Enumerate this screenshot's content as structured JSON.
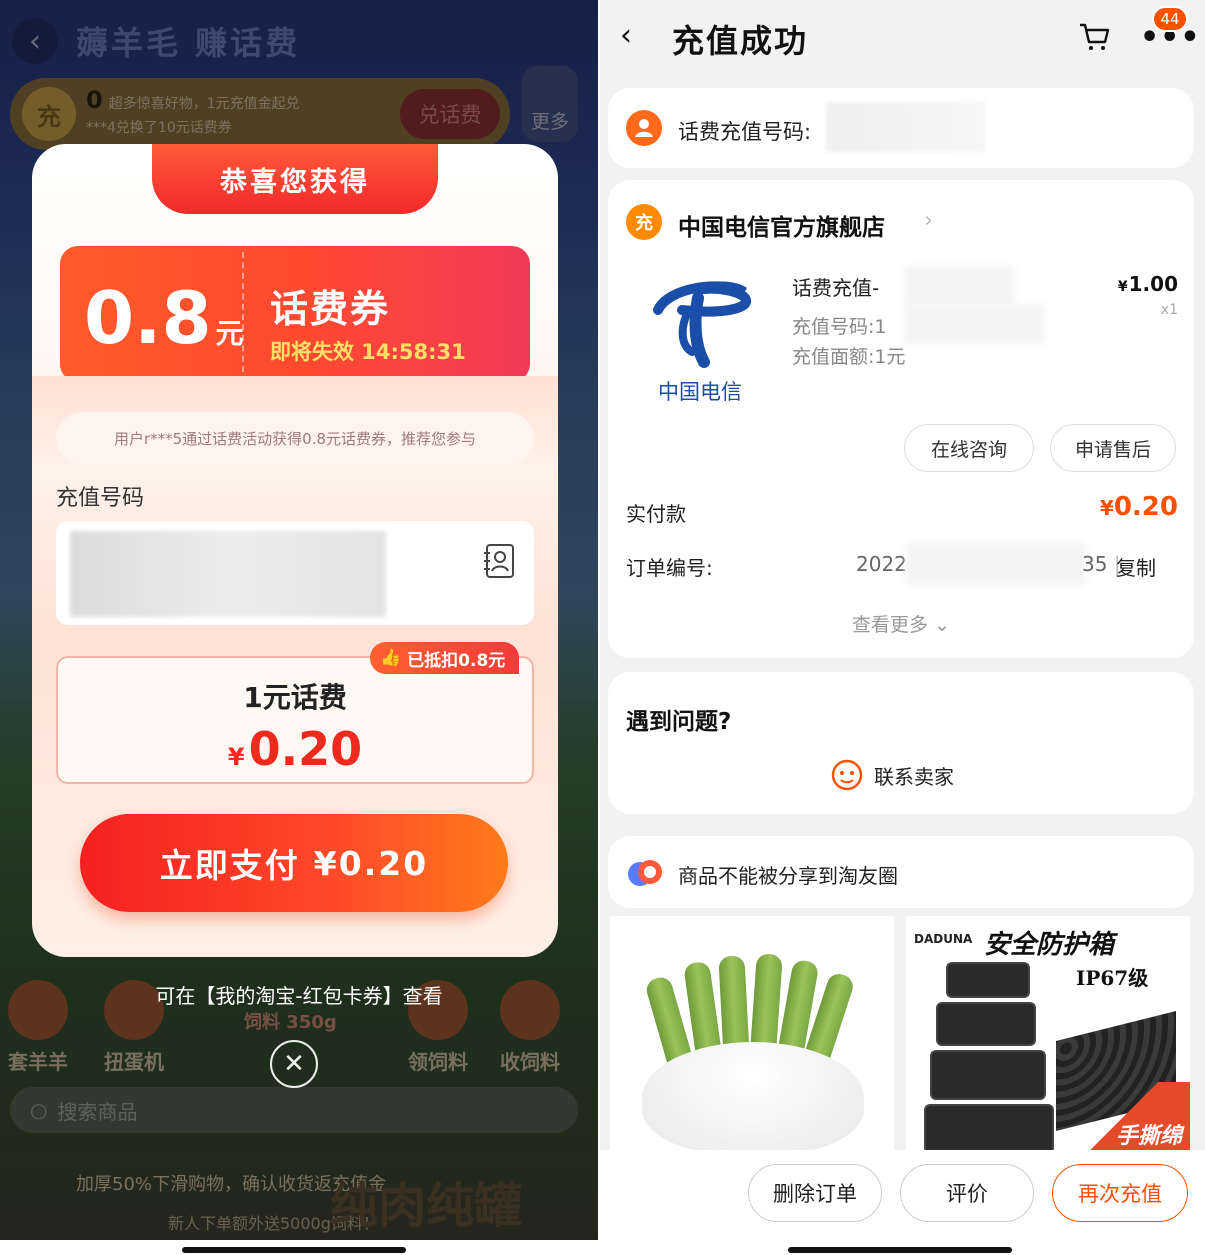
{
  "left": {
    "game": {
      "title": "薅羊毛 赚话费",
      "banner_count": "0",
      "banner_line1": "超多惊喜好物，1元充值金起兑",
      "banner_line2": "***4兑换了10元话费券",
      "banner_badge": "充",
      "banner_button": "兑话费",
      "more_label": "更多",
      "icons": [
        "套羊羊",
        "扭蛋机",
        "领饲料",
        "收饲料"
      ],
      "feed_label": "饲料 350g",
      "search_placeholder": "搜索商品",
      "promo1": "加厚50%下滑购物，确认收货返充值金",
      "promo2": "新人下单额外送5000g饲料！",
      "promo3": "纯肉纯罐"
    },
    "modal": {
      "header": "恭喜您获得",
      "coupon_value": "0.8",
      "coupon_unit": "元",
      "coupon_name": "话费券",
      "coupon_expiry": "即将失效 14:58:31",
      "promo_text": "用户r***5通过话费活动获得0.8元话费券，推荐您参与",
      "number_label": "充值号码",
      "deduct_tag": "已抵扣0.8元",
      "product_title": "1元话费",
      "currency": "¥",
      "price": "0.20",
      "pay_label": "立即支付",
      "pay_amount": "¥0.20"
    },
    "hint": "可在【我的淘宝-红包卡券】查看"
  },
  "right": {
    "nav": {
      "title": "充值成功",
      "badge": "44"
    },
    "recharge_number_label": "话费充值号码:",
    "shop_icon_char": "充",
    "shop_name": "中国电信官方旗舰店",
    "logo_caption": "中国电信",
    "product": {
      "title": "话费充值-",
      "number_label": "充值号码:1",
      "face_value": "充值面额:1元",
      "currency": "¥",
      "price": "1.00",
      "qty": "x1"
    },
    "actions": {
      "consult": "在线咨询",
      "after_sale": "申请售后"
    },
    "paid_label": "实付款",
    "paid_currency": "¥",
    "paid_value": "0.20",
    "order_label": "订单编号:",
    "order_prefix": "2022",
    "order_suffix": "35",
    "copy": "复制",
    "view_more": "查看更多",
    "problem_title": "遇到问题?",
    "contact_seller": "联系卖家",
    "share_notice": "商品不能被分享到淘友圈",
    "ad2": {
      "brand": "DADUNA",
      "title": "安全防护箱",
      "spec": "IP67级",
      "corner": "手撕绵"
    },
    "bottom": {
      "delete": "删除订单",
      "review": "评价",
      "recharge_again": "再次充值"
    },
    "colors": {
      "accent": "#ff5000",
      "telecom_blue": "#1b4ea8"
    }
  }
}
